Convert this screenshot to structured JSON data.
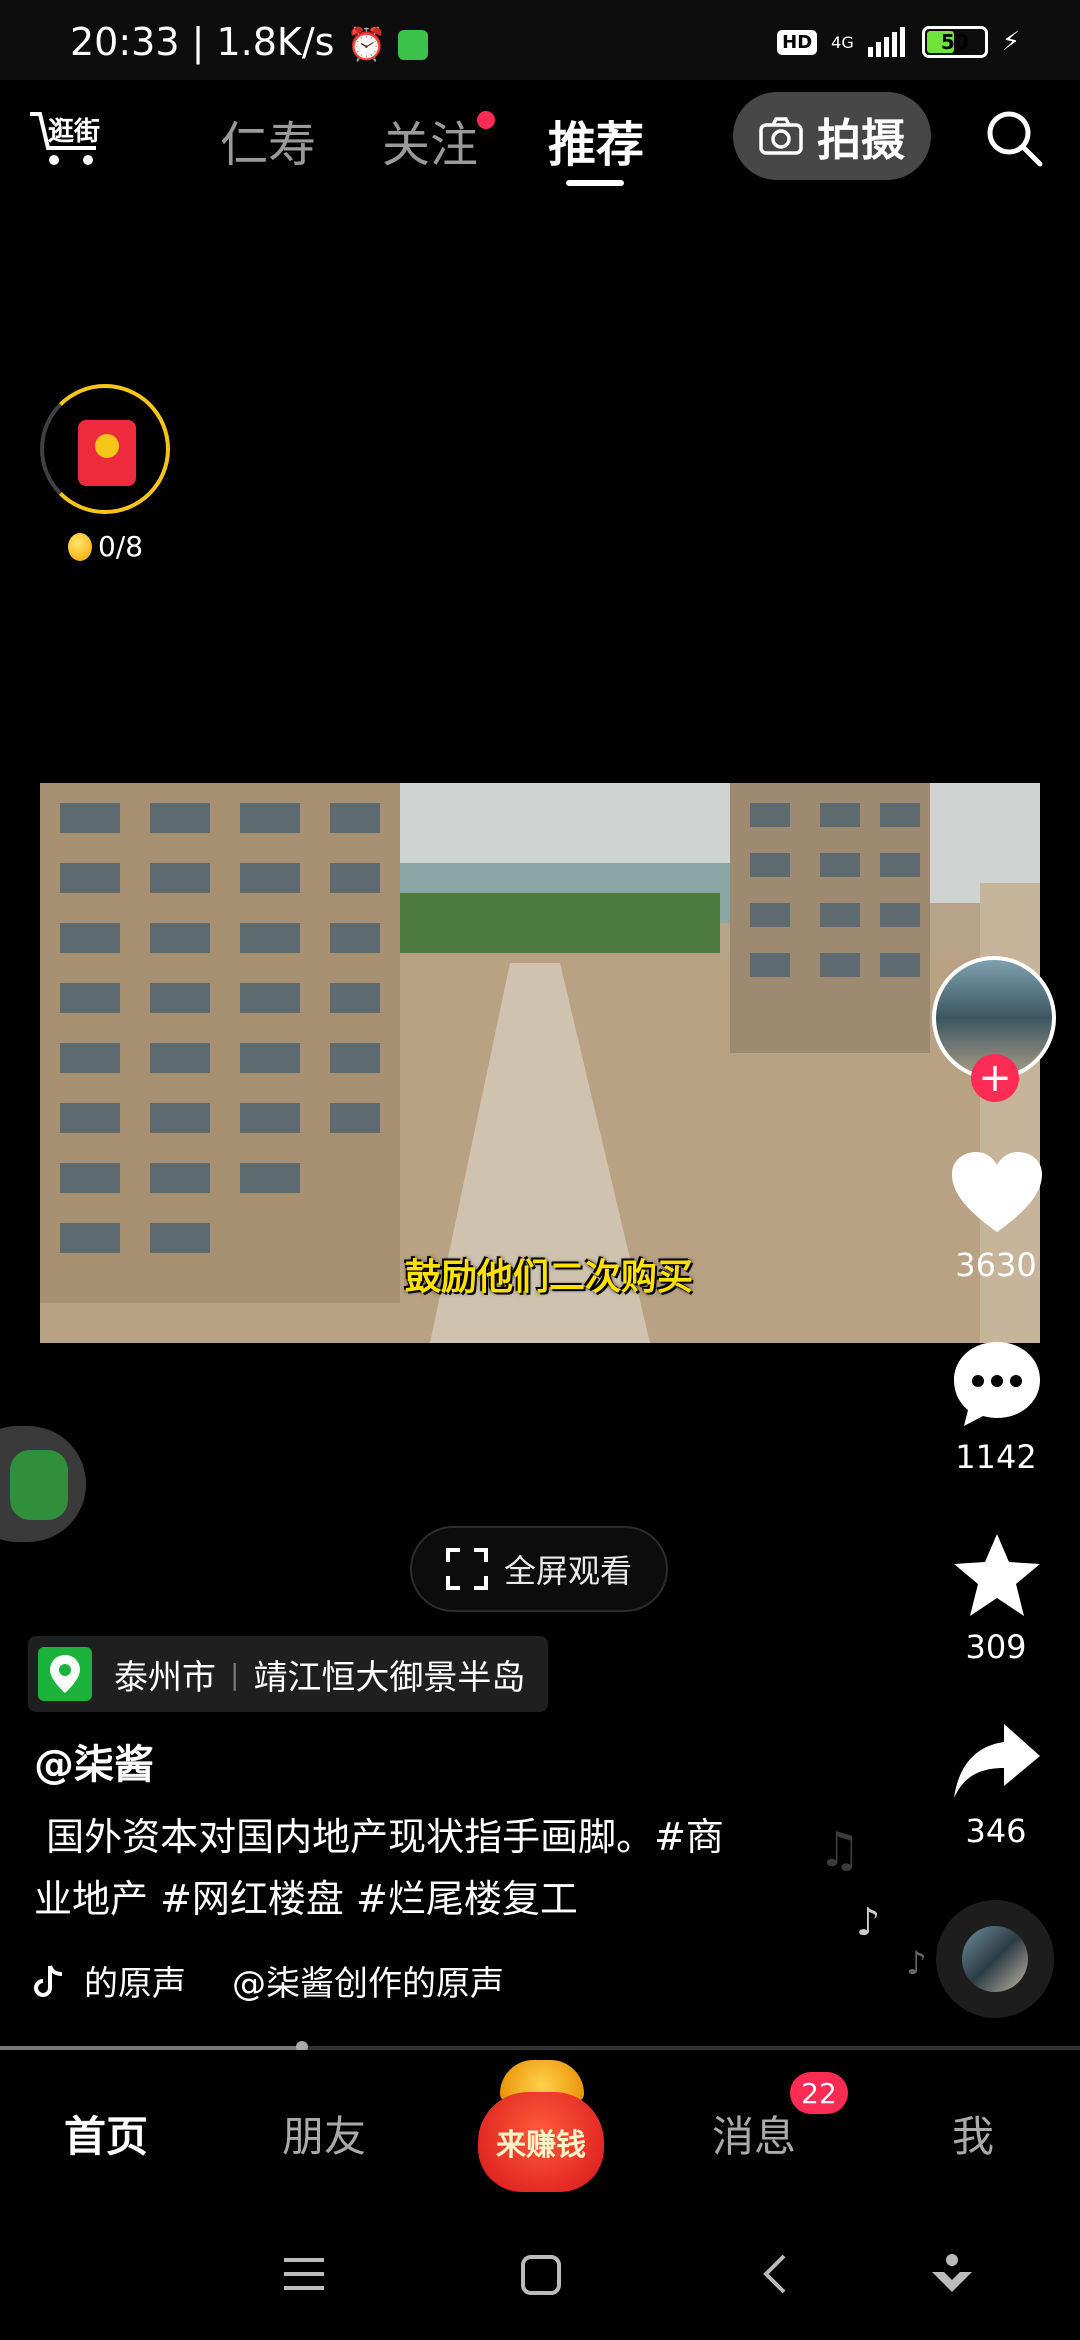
{
  "status_bar": {
    "time": "20:33",
    "net_speed": "1.8K/s",
    "hd": "HD",
    "network": "4G",
    "battery": "50"
  },
  "top_nav": {
    "tabs": [
      {
        "label": "仁寿",
        "active": false
      },
      {
        "label": "关注",
        "active": false,
        "has_dot": true
      },
      {
        "label": "推荐",
        "active": true
      }
    ],
    "shoot_label": "拍摄",
    "logo_text": "逛街"
  },
  "red_packet": {
    "progress": "0/8"
  },
  "video": {
    "caption": "鼓励他们二次购买"
  },
  "right_rail": {
    "likes": "3630",
    "comments": "1142",
    "favorites": "309",
    "shares": "346"
  },
  "fullscreen": {
    "label": "全屏观看"
  },
  "location": {
    "city": "泰州市",
    "place": "靖江恒大御景半岛"
  },
  "post": {
    "author": "@柒酱",
    "desc_line1": " 国外资本对国内地产现状指手画脚。#商",
    "desc_line2": "业地产 #网红楼盘 #烂尾楼复工",
    "music_prefix": "的原声",
    "music_title": "@柒酱创作的原声"
  },
  "playback": {
    "progress": 0.28
  },
  "bottom_nav": {
    "home": "首页",
    "friends": "朋友",
    "earn": "来赚钱",
    "messages": "消息",
    "messages_badge": "22",
    "me": "我"
  },
  "colors": {
    "accent": "#fe2c55",
    "caption": "#ffe100",
    "location_pin": "#1bb33c"
  }
}
